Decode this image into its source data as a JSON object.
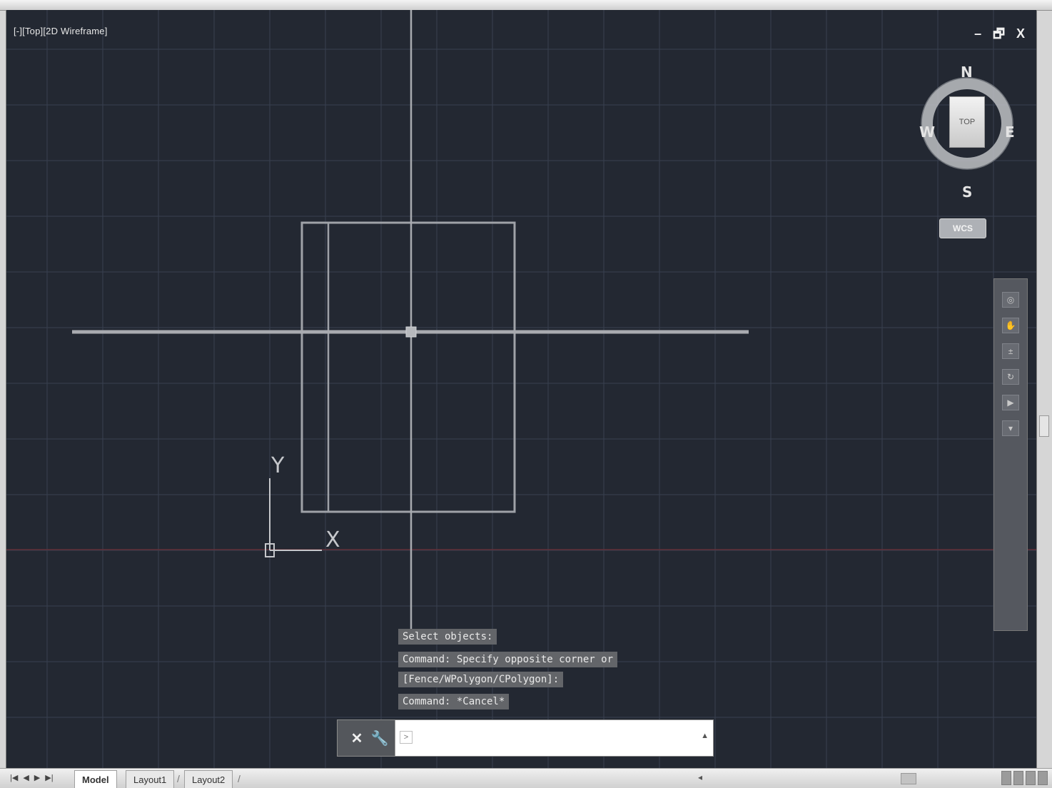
{
  "viewport": {
    "label": "[-][Top][2D Wireframe]",
    "window_controls": {
      "minimize": "–",
      "restore": "🗗",
      "close": "X"
    }
  },
  "viewcube": {
    "compass": {
      "north": "N",
      "south": "S",
      "east": "E",
      "west": "W"
    },
    "face_label": "TOP",
    "wcs_label": "WCS"
  },
  "ucs_icon": {
    "x_label": "X",
    "y_label": "Y"
  },
  "command_history": [
    "Select objects:",
    "Command: Specify opposite corner or",
    "[Fence/WPolygon/CPolygon]:",
    "Command: *Cancel*"
  ],
  "command_line": {
    "close_icon": "close-icon",
    "customize_icon": "wrench-icon",
    "prompt_icon": "command-prompt-icon",
    "placeholder": "",
    "value": ""
  },
  "layout_tabs": [
    {
      "label": "Model",
      "active": true
    },
    {
      "label": "Layout1",
      "active": false
    },
    {
      "label": "Layout2",
      "active": false
    }
  ],
  "colors": {
    "canvas_background": "#232832",
    "grid_major": "#384050",
    "crosshair": "#a9abb0",
    "geometry": "#9fa2a8",
    "ucs": "#c5c7cb",
    "x_axis_red": "#6b2d35"
  }
}
